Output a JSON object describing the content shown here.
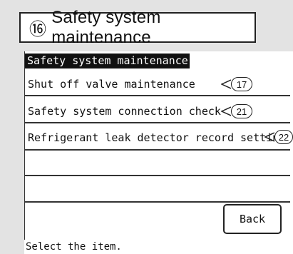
{
  "screen": {
    "number": "⑯",
    "title": "Safety system maintenance"
  },
  "menu": {
    "title": "Safety system maintenance",
    "items": [
      {
        "label": "Shut off valve maintenance",
        "ref": "17"
      },
      {
        "label": "Safety system connection check",
        "ref": "21"
      },
      {
        "label": "Refrigerant leak detector record setting",
        "ref": "22"
      }
    ]
  },
  "back_button": "Back",
  "status_text": "Select the item."
}
